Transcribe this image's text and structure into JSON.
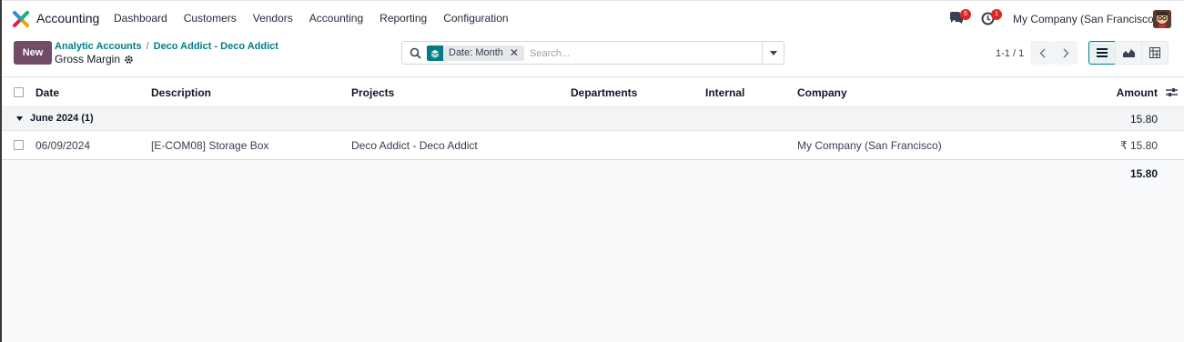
{
  "navbar": {
    "app_name": "Accounting",
    "menu": [
      "Dashboard",
      "Customers",
      "Vendors",
      "Accounting",
      "Reporting",
      "Configuration"
    ],
    "chat_badge": "5",
    "activity_badge": "1",
    "company": "My Company (San Francisco)"
  },
  "control": {
    "new_label": "New",
    "breadcrumb": [
      "Analytic Accounts",
      "Deco Addict - Deco Addict"
    ],
    "breadcrumb_sep": "/",
    "subtitle": "Gross Margin",
    "facet_label": "Date: Month",
    "search_placeholder": "Search...",
    "pager": "1-1 / 1"
  },
  "table": {
    "columns": [
      "Date",
      "Description",
      "Projects",
      "Departments",
      "Internal",
      "Company",
      "Amount"
    ],
    "group": {
      "label": "June 2024 (1)",
      "amount": "15.80"
    },
    "rows": [
      {
        "date": "06/09/2024",
        "description": "[E-COM08] Storage Box",
        "projects": "Deco Addict - Deco Addict",
        "departments": "",
        "internal": "",
        "company": "My Company (San Francisco)",
        "amount": "₹ 15.80"
      }
    ],
    "total": "15.80"
  },
  "colors": {
    "primary": "#714b67",
    "accent": "#017e84",
    "badge": "#dc2626"
  },
  "icons": [
    "app-logo-icon",
    "chat-icon",
    "activity-clock-icon",
    "gear-icon",
    "search-icon",
    "layers-icon",
    "close-icon",
    "caret-down-icon",
    "chevron-left-icon",
    "chevron-right-icon",
    "list-view-icon",
    "graph-view-icon",
    "pivot-view-icon",
    "column-settings-icon",
    "group-caret-icon"
  ]
}
